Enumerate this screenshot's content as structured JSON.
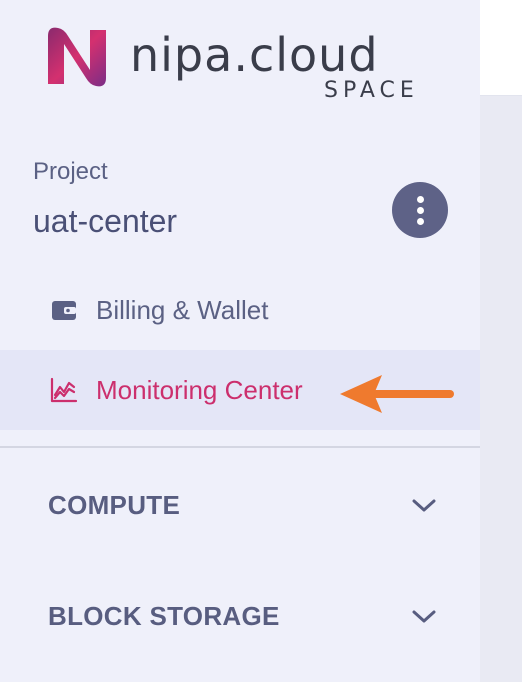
{
  "logo": {
    "brand": "nipa.cloud",
    "sub": "SPACE",
    "mark_color": "#d4306f"
  },
  "project": {
    "label": "Project",
    "name": "uat-center",
    "menu_icon": "more-vertical-icon"
  },
  "nav": {
    "billing": {
      "label": "Billing & Wallet",
      "icon": "wallet-icon"
    },
    "monitoring": {
      "label": "Monitoring Center",
      "icon": "chart-line-icon",
      "active": true
    }
  },
  "sections": {
    "compute": {
      "label": "COMPUTE",
      "icon": "chevron-down-icon"
    },
    "block_storage": {
      "label": "BLOCK STORAGE",
      "icon": "chevron-down-icon"
    }
  },
  "colors": {
    "accent": "#d4306f",
    "text": "#5b6184",
    "arrow": "#ef7a2e"
  }
}
